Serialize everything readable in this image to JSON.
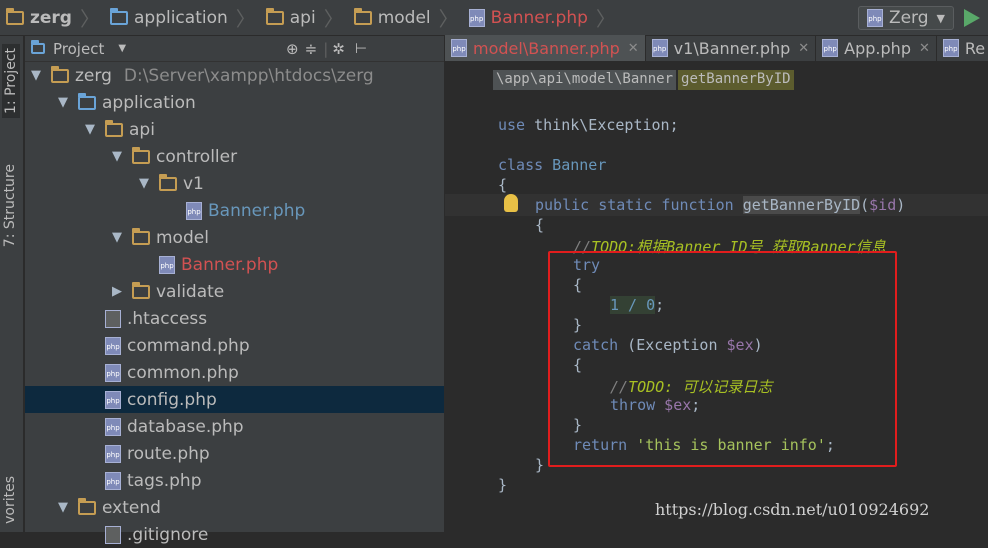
{
  "breadcrumb": [
    "zerg",
    "application",
    "api",
    "model",
    "Banner.php"
  ],
  "run_config": "Zerg",
  "side_tabs": {
    "project": "1: Project",
    "structure": "7: Structure",
    "favorites": "vorites"
  },
  "panel": {
    "title": "Project"
  },
  "tree": [
    {
      "label": "zerg",
      "path": "D:\\Server\\xampp\\htdocs\\zerg",
      "type": "folder",
      "depth": 0,
      "expanded": true
    },
    {
      "label": "application",
      "type": "folder-blue",
      "depth": 1,
      "expanded": true
    },
    {
      "label": "api",
      "type": "folder",
      "depth": 2,
      "expanded": true
    },
    {
      "label": "controller",
      "type": "folder",
      "depth": 3,
      "expanded": true
    },
    {
      "label": "v1",
      "type": "folder",
      "depth": 4,
      "expanded": true
    },
    {
      "label": "Banner.php",
      "type": "php",
      "depth": 5,
      "color": "blue"
    },
    {
      "label": "model",
      "type": "folder",
      "depth": 3,
      "expanded": true
    },
    {
      "label": "Banner.php",
      "type": "php",
      "depth": 4,
      "color": "red"
    },
    {
      "label": "validate",
      "type": "folder",
      "depth": 3,
      "expanded": false
    },
    {
      "label": ".htaccess",
      "type": "file",
      "depth": 2
    },
    {
      "label": "command.php",
      "type": "php",
      "depth": 2
    },
    {
      "label": "common.php",
      "type": "php",
      "depth": 2
    },
    {
      "label": "config.php",
      "type": "php",
      "depth": 2,
      "selected": true
    },
    {
      "label": "database.php",
      "type": "php",
      "depth": 2
    },
    {
      "label": "route.php",
      "type": "php",
      "depth": 2
    },
    {
      "label": "tags.php",
      "type": "php",
      "depth": 2
    },
    {
      "label": "extend",
      "type": "folder",
      "depth": 1,
      "expanded": true
    },
    {
      "label": ".gitignore",
      "type": "file",
      "depth": 2
    }
  ],
  "editor_tabs": [
    {
      "label": "model\\Banner.php",
      "active": true
    },
    {
      "label": "v1\\Banner.php",
      "active": false
    },
    {
      "label": "App.php",
      "active": false
    },
    {
      "label": "Re",
      "active": false
    }
  ],
  "code_breadcrumb": {
    "path": "\\app\\api\\model\\Banner",
    "func": "getBannerByID"
  },
  "code": {
    "use_kw": "use",
    "use_ns": " think\\Exception;",
    "class_kw": "class",
    "class_name": " Banner",
    "brace_open": "{",
    "brace_close": "}",
    "fn_mods": "public static function ",
    "fn_name": "getBannerByID",
    "fn_paren_open": "(",
    "fn_param": "$id",
    "fn_paren_close": ")",
    "todo_prefix": "//",
    "todo_text": "TODO:根据Banner ID号 获取Banner信息",
    "try_kw": "try",
    "div_expr": "1 / 0",
    "semi": ";",
    "catch_kw": "catch",
    "catch_open": " (Exception ",
    "catch_var": "$ex",
    "catch_close": ")",
    "todo2_prefix": "//",
    "todo2_text": "TODO: 可以记录日志",
    "throw_kw": "throw",
    "throw_var": " $ex",
    "throw_semi": ";",
    "return_kw": "return",
    "return_str": " 'this is banner info'",
    "return_semi": ";"
  },
  "watermark": "https://blog.csdn.net/u010924692"
}
